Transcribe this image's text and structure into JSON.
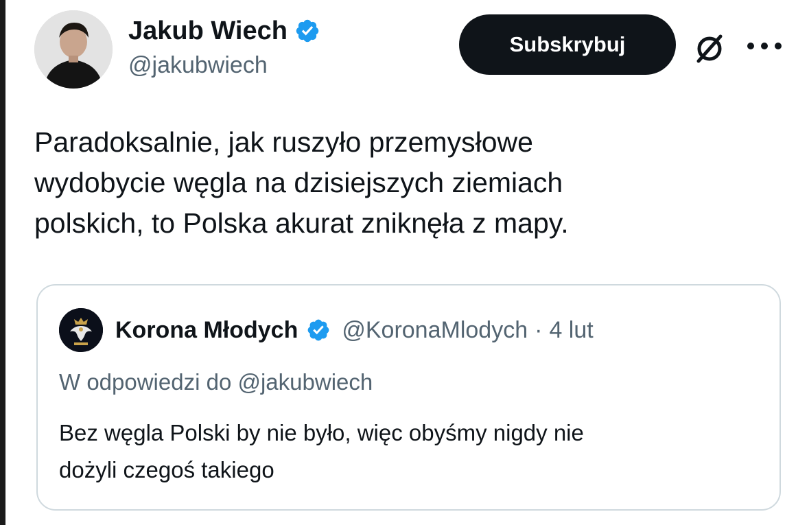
{
  "author": {
    "name": "Jakub Wiech",
    "handle": "@jakubwiech",
    "verified": true,
    "avatar_icon": "profile-photo-avatar"
  },
  "actions": {
    "subscribe_label": "Subskrybuj",
    "grok_icon": "grok-icon",
    "more_icon": "more-options-icon"
  },
  "tweet": {
    "text_lines": [
      "Paradoksalnie, jak ruszyło przemysłowe",
      "wydobycie węgla na dzisiejszych ziemiach",
      "polskich, to Polska akurat zniknęła z mapy."
    ]
  },
  "quoted_tweet": {
    "author_name": "Korona Młodych",
    "handle": "@KoronaMlodych",
    "separator": "·",
    "date": "4 lut",
    "verified": true,
    "reply_context": "W odpowiedzi do @jakubwiech",
    "text_lines": [
      "Bez węgla Polski by nie było, więc obyśmy nigdy nie",
      "dożyli czegoś takiego"
    ],
    "avatar_icon": "eagle-crown-logo-avatar"
  },
  "colors": {
    "verified_blue": "#1d9bf0",
    "secondary_text": "#536471",
    "primary_text": "#0f1419",
    "button_bg": "#0f1419",
    "border": "#cfd9de"
  }
}
